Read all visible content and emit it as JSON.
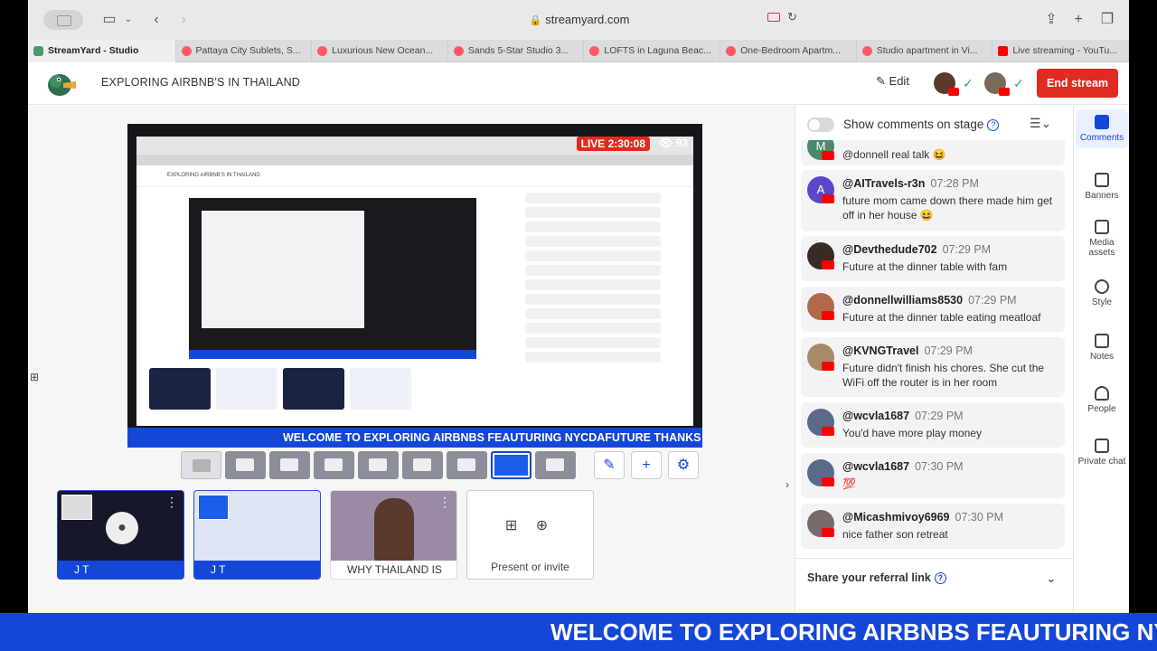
{
  "browser": {
    "url": "streamyard.com",
    "tabs": [
      {
        "label": "StreamYard - Studio",
        "active": true
      },
      {
        "label": "Pattaya City Sublets, S..."
      },
      {
        "label": "Luxurious New Ocean..."
      },
      {
        "label": "Sands 5-Star Studio 3..."
      },
      {
        "label": "LOFTS in Laguna Beac..."
      },
      {
        "label": "One-Bedroom Apartm..."
      },
      {
        "label": "Studio apartment in Vi..."
      },
      {
        "label": "Live streaming - YouTu..."
      }
    ]
  },
  "header": {
    "title": "EXPLORING AIRBNB'S IN THAILAND",
    "edit_label": "Edit",
    "end_label": "End stream"
  },
  "stage": {
    "live_label": "LIVE 2:30:08",
    "viewers": "93",
    "banner": "WELCOME TO EXPLORING AIRBNBS FEAUTURING NYCDAFUTURE THANKS",
    "mini_title": "EXPLORING AIRBNB'S IN THAILAND"
  },
  "sources": [
    {
      "label": "J T"
    },
    {
      "label": "J T"
    },
    {
      "label": "WHY THAILAND IS R..."
    },
    {
      "label": "Present or invite"
    }
  ],
  "comments_panel": {
    "toggle_label": "Show comments on stage",
    "referral_label": "Share your referral link",
    "comments": [
      {
        "name": "",
        "time": "",
        "text": "@donnell real talk 😆",
        "initial": "M"
      },
      {
        "name": "@AITravels-r3n",
        "time": "07:28 PM",
        "text": "future mom came down there made him get off in her house 😆",
        "initial": "A"
      },
      {
        "name": "@Devthedude702",
        "time": "07:29 PM",
        "text": "Future at the dinner table with fam",
        "initial": ""
      },
      {
        "name": "@donnellwilliams8530",
        "time": "07:29 PM",
        "text": "Future at the dinner table eating meatloaf",
        "initial": ""
      },
      {
        "name": "@KVNGTravel",
        "time": "07:29 PM",
        "text": "Future didn't finish his chores. She cut the WiFi off the router is in her room",
        "initial": ""
      },
      {
        "name": "@wcvla1687",
        "time": "07:29 PM",
        "text": "You'd have more play money",
        "initial": ""
      },
      {
        "name": "@wcvla1687",
        "time": "07:30 PM",
        "text": "💯",
        "initial": ""
      },
      {
        "name": "@Micashmivoy6969",
        "time": "07:30 PM",
        "text": "nice father son retreat",
        "initial": ""
      }
    ]
  },
  "rail": [
    {
      "label": "Comments"
    },
    {
      "label": "Banners"
    },
    {
      "label": "Media assets"
    },
    {
      "label": "Style"
    },
    {
      "label": "Notes"
    },
    {
      "label": "People"
    },
    {
      "label": "Private chat"
    }
  ],
  "ticker": "WELCOME TO EXPLORING AIRBNBS FEAUTURING NYCDAFUTURE THANKS",
  "colors": {
    "accent": "#1446d8",
    "end": "#e02b20"
  }
}
